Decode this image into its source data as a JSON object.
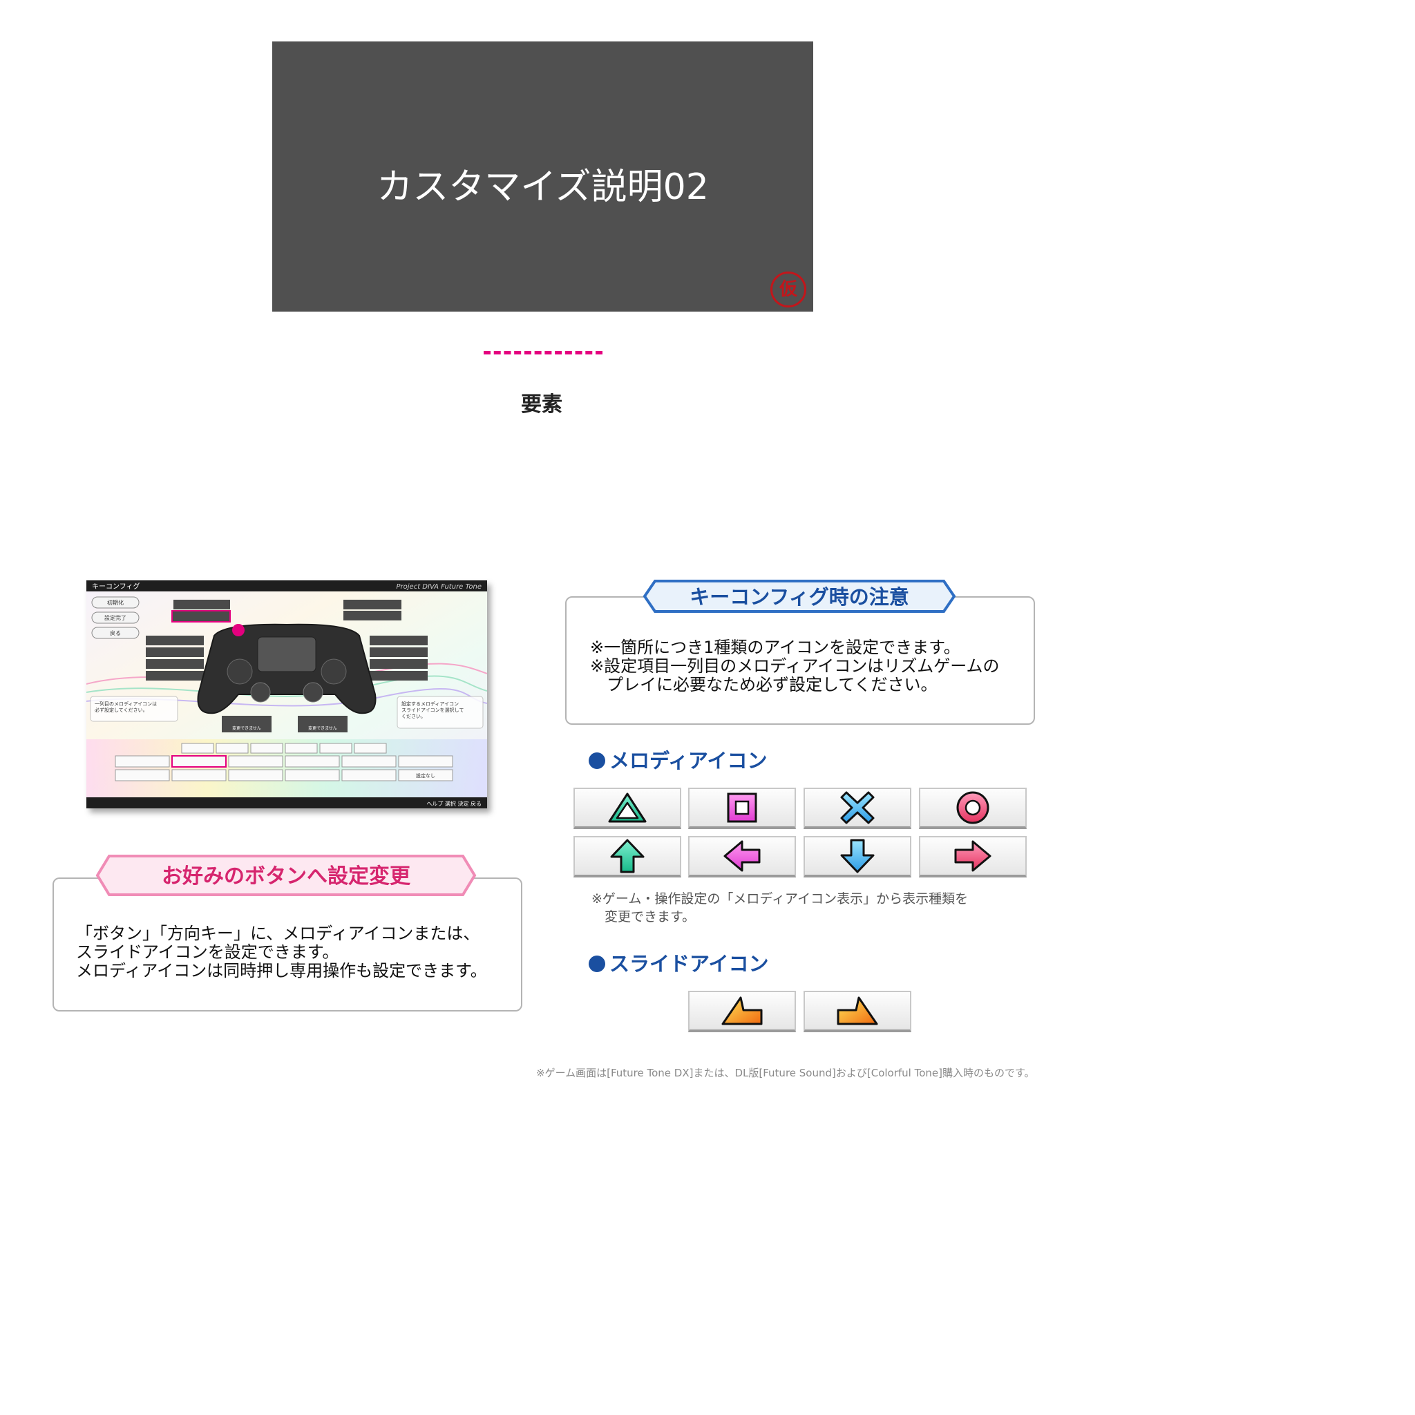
{
  "hero": {
    "title": "カスタマイズ説明02",
    "stamp": "仮"
  },
  "section_label": "要素",
  "screenshot": {
    "header_title": "キーコンフィグ",
    "header_logo": "Project DIVA Future Tone",
    "menu": [
      "初期化",
      "設定完了",
      "戻る"
    ],
    "left_note": "一列目のメロディアイコンは\n必ず設定してください。",
    "right_note": "設定するメロディアイコン\nスライドアイコンを選択して\nください。",
    "lock_label": "変更できません",
    "none_label": "設定なし",
    "footer": "ヘルプ  選択  決定  戻る"
  },
  "custom_panel": {
    "banner": "お好みのボタンへ設定変更",
    "body": "「ボタン」「方向キー」に、メロディアイコンまたは、\nスライドアイコンを設定できます。\nメロディアイコンは同時押し専用操作も設定できます。"
  },
  "caution_panel": {
    "banner": "キーコンフィグ時の注意",
    "lines": [
      "※一箇所につき1種類のアイコンを設定できます。",
      "※設定項目一列目のメロディアイコンはリズムゲームの",
      "　プレイに必要なため必ず設定してください。"
    ]
  },
  "melody": {
    "heading": "メロディアイコン",
    "icons": [
      "triangle-icon",
      "square-icon",
      "cross-icon",
      "circle-icon",
      "arrow-up-icon",
      "arrow-left-icon",
      "arrow-down-icon",
      "arrow-right-icon"
    ],
    "note_lines": [
      "※ゲーム・操作設定の「メロディアイコン表示」から表示種類を",
      "　変更できます。"
    ]
  },
  "slide": {
    "heading": "スライドアイコン",
    "icons": [
      "slide-left-icon",
      "slide-right-icon"
    ]
  },
  "footnote": "※ゲーム画面は[Future Tone DX]または、DL版[Future Sound]および[Colorful Tone]購入時のものです。",
  "colors": {
    "hero_bg": "#505050",
    "accent_pink": "#e4007f",
    "heading_blue": "#1a4fa0",
    "banner_pink_text": "#d6256e",
    "banner_blue_text": "#1a4fa0"
  }
}
